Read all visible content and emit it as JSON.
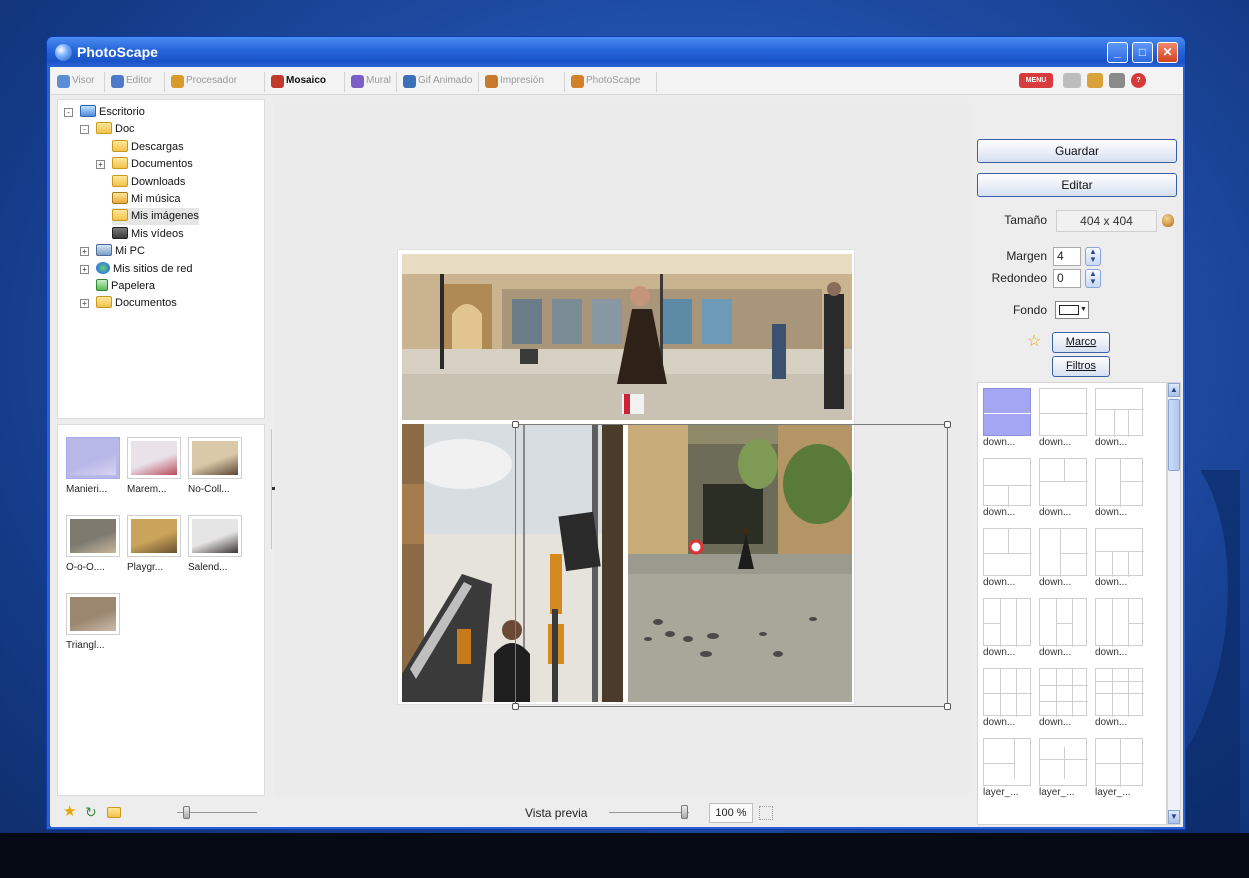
{
  "window": {
    "title": "PhotoScape",
    "controls": {
      "minimize": "_",
      "maximize": "□",
      "close": "✕"
    }
  },
  "tabs": [
    {
      "label": "Visor",
      "icon": "viewer-icon",
      "color": "#5a8fd8"
    },
    {
      "label": "Editor",
      "icon": "editor-icon",
      "color": "#4e7bc7"
    },
    {
      "label": "Procesador",
      "icon": "batch-icon",
      "color": "#d99a2b"
    },
    {
      "label": "Mosaico",
      "icon": "page-icon",
      "color": "#c0392b",
      "active": true
    },
    {
      "label": "Mural",
      "icon": "combine-icon",
      "color": "#7a5fc7"
    },
    {
      "label": "Gif Animado",
      "icon": "gif-icon",
      "color": "#3d6fb8"
    },
    {
      "label": "Impresión",
      "icon": "print-icon",
      "color": "#c77a2b"
    },
    {
      "label": "PhotoScape",
      "icon": "photoscape-icon",
      "color": "#d4802b"
    }
  ],
  "top_icons": [
    {
      "name": "menu-icon",
      "text": "MENU",
      "color": "#d83b3b"
    },
    {
      "name": "keyboard-icon",
      "text": "",
      "color": "#bdbdbd"
    },
    {
      "name": "home-icon",
      "text": "",
      "color": "#d9a23a"
    },
    {
      "name": "copy-icon",
      "text": "",
      "color": "#8a8a8a"
    },
    {
      "name": "help-icon",
      "text": "?",
      "color": "#d63a3a"
    }
  ],
  "tree": [
    {
      "label": "Escritorio",
      "icon": "desk",
      "exp": "-"
    },
    {
      "label": "Doc",
      "icon": "folder",
      "exp": "-"
    },
    {
      "label": "Descargas",
      "icon": "folder",
      "exp": ""
    },
    {
      "label": "Documentos",
      "icon": "folder",
      "exp": "+"
    },
    {
      "label": "Downloads",
      "icon": "folder",
      "exp": ""
    },
    {
      "label": "Mi música",
      "icon": "music",
      "exp": ""
    },
    {
      "label": "Mis imágenes",
      "icon": "folder",
      "exp": "",
      "selected": true
    },
    {
      "label": "Mis vídeos",
      "icon": "video",
      "exp": ""
    },
    {
      "label": "Mi PC",
      "icon": "pc",
      "exp": "+"
    },
    {
      "label": "Mis sitios de red",
      "icon": "net",
      "exp": "+"
    },
    {
      "label": "Papelera",
      "icon": "bin",
      "exp": ""
    },
    {
      "label": "Documentos",
      "icon": "folder",
      "exp": "+"
    }
  ],
  "thumbnails": [
    {
      "label": "Manieri...",
      "colors": [
        "#b7b7e8",
        "#d8d3ef"
      ]
    },
    {
      "label": "Marem...",
      "colors": [
        "#e9e2e8",
        "#b84a5c"
      ]
    },
    {
      "label": "No-Coll...",
      "colors": [
        "#d9c9a8",
        "#5a4635"
      ]
    },
    {
      "label": "O-o-O....",
      "colors": [
        "#7e7a70",
        "#c8b79a"
      ]
    },
    {
      "label": "Playgr...",
      "colors": [
        "#c9a45a",
        "#6a5030"
      ]
    },
    {
      "label": "Salend...",
      "colors": [
        "#e5e5e5",
        "#3e3430"
      ]
    },
    {
      "label": "Triangl...",
      "colors": [
        "#9b8670",
        "#c9bba8"
      ]
    }
  ],
  "status": {
    "preview_label": "Vista previa",
    "zoom": "100 %"
  },
  "zoom_level": 1.0,
  "right_panel": {
    "save_label": "Guardar",
    "edit_label": "Editar",
    "size_label": "Tamaño",
    "size_value": "404 x 404",
    "margin_label": "Margen",
    "margin_value": "4",
    "round_label": "Redondeo",
    "round_value": "0",
    "bg_label": "Fondo",
    "frame_label": "Marco",
    "filters_label": "Filtros"
  },
  "layouts": [
    {
      "label": "down...",
      "selected": true
    },
    {
      "label": "down..."
    },
    {
      "label": "down..."
    },
    {
      "label": "down..."
    },
    {
      "label": "down..."
    },
    {
      "label": "down..."
    },
    {
      "label": "down..."
    },
    {
      "label": "down..."
    },
    {
      "label": "down..."
    },
    {
      "label": "down..."
    },
    {
      "label": "down..."
    },
    {
      "label": "down..."
    },
    {
      "label": "down..."
    },
    {
      "label": "down..."
    },
    {
      "label": "down..."
    },
    {
      "label": "layer_..."
    },
    {
      "label": "layer_..."
    },
    {
      "label": "layer_..."
    }
  ]
}
